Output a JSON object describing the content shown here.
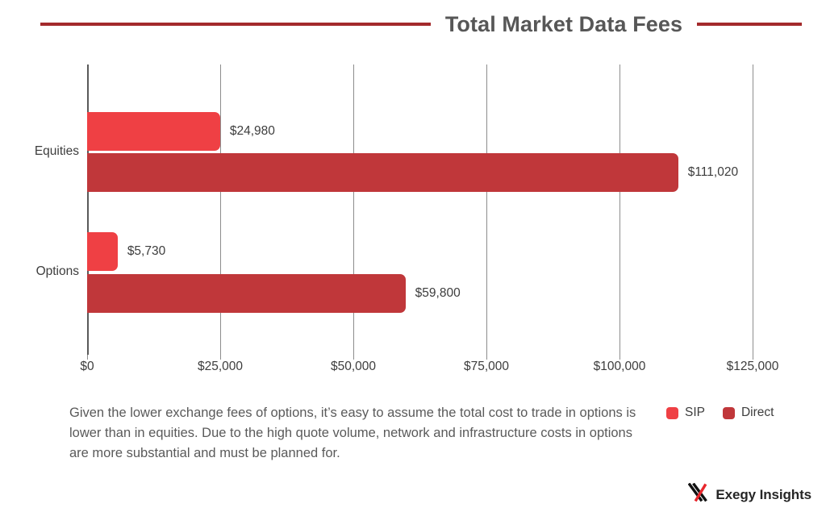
{
  "header": {
    "title": "Total Market Data Fees",
    "rule_color": "#a32a2c"
  },
  "chart_data": {
    "type": "bar",
    "orientation": "horizontal",
    "title": "Total Market Data Fees",
    "xlabel": "",
    "ylabel": "",
    "categories": [
      "Equities",
      "Options"
    ],
    "series": [
      {
        "name": "SIP",
        "color": "#EF4044",
        "values": [
          24980,
          5730
        ],
        "value_labels": [
          "$24,980",
          "$5,730"
        ]
      },
      {
        "name": "Direct",
        "color": "#C0373A",
        "values": [
          111020,
          59800
        ],
        "value_labels": [
          "$111,020",
          "$59,800"
        ]
      }
    ],
    "xlim": [
      0,
      125000
    ],
    "xticks": [
      0,
      25000,
      50000,
      75000,
      100000,
      125000
    ],
    "xticklabels": [
      "$0",
      "$25,000",
      "$50,000",
      "$75,000",
      "$100,000",
      "$125,000"
    ],
    "grid": "vertical",
    "legend_position": "bottom-right",
    "legend": [
      "SIP",
      "Direct"
    ]
  },
  "footer": {
    "caption": "Given the lower exchange fees of options, it’s easy to assume the total cost to trade in options is lower than in equities. Due to the high quote volume, network and infrastructure costs in options are more substantial and must be planned for.",
    "brand": "Exegy Insights"
  }
}
